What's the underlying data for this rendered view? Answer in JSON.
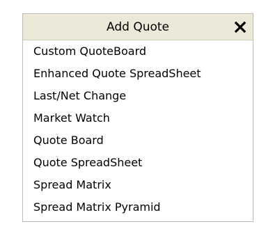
{
  "popup": {
    "title": "Add Quote",
    "close_icon": "close-icon",
    "items": [
      {
        "label": "Custom QuoteBoard"
      },
      {
        "label": "Enhanced Quote SpreadSheet"
      },
      {
        "label": "Last/Net Change"
      },
      {
        "label": "Market Watch"
      },
      {
        "label": "Quote Board"
      },
      {
        "label": "Quote SpreadSheet"
      },
      {
        "label": "Spread Matrix"
      },
      {
        "label": "Spread Matrix Pyramid"
      }
    ]
  },
  "colors": {
    "title_bar_bg": "#ece9d8",
    "border": "#bcbcbc",
    "text": "#000000"
  }
}
